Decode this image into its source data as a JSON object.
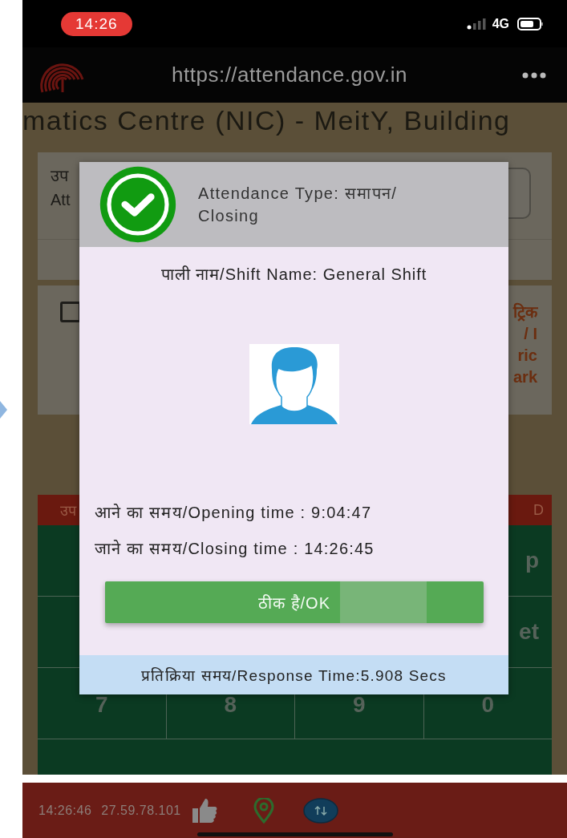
{
  "status_bar": {
    "time": "14:26",
    "network": "4G"
  },
  "browser": {
    "url": "https://attendance.gov.in"
  },
  "page": {
    "title": "matics Centre (NIC) - MeitY, Building",
    "card_1_texts": [
      "उप",
      "Att"
    ],
    "checkbox": {
      "checked": false
    },
    "card_2_texts": [
      "ट्रिक",
      "/ I",
      "ric",
      "ark"
    ],
    "table_header": [
      "उप",
      "D"
    ],
    "keypad_rows": [
      [
        "p"
      ],
      [
        "et"
      ],
      [
        "7",
        "8",
        "9",
        "0"
      ]
    ]
  },
  "dialog": {
    "title": "Attendance Type: समापन/ Closing",
    "shift": "पाली नाम/Shift Name: General Shift",
    "opening": "आने का समय/Opening time : 9:04:47",
    "closing": "जाने का समय/Closing time : 14:26:45",
    "ok_button": "ठीक है/OK",
    "response_time": "प्रतिक्रिया समय/Response Time:5.908 Secs"
  },
  "footer": {
    "time": "14:26:46",
    "ip": "27.59.78.101"
  }
}
